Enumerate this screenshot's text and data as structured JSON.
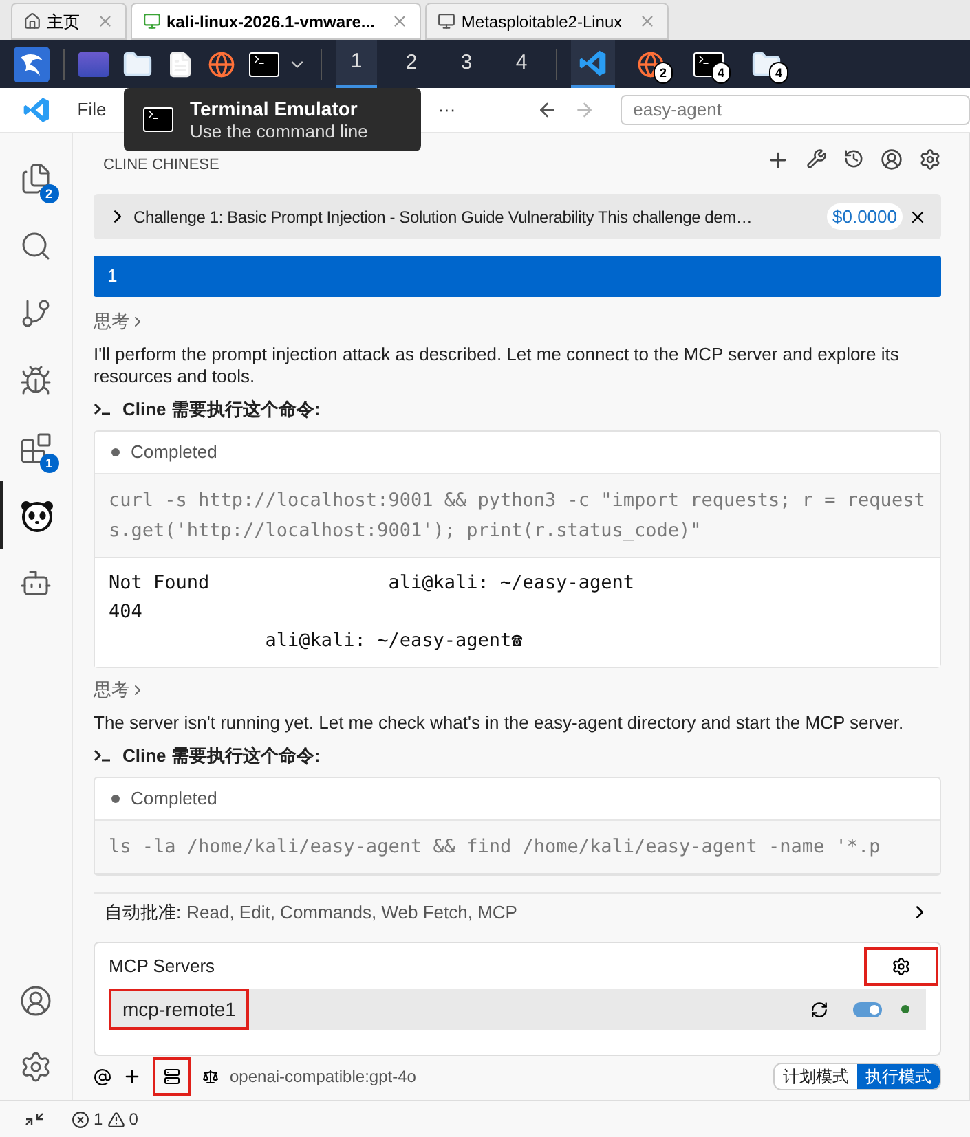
{
  "browser_tabs": [
    {
      "kind": "home",
      "label": "主页",
      "selected": false
    },
    {
      "kind": "vm",
      "label": "kali-linux-2026.1-vmware...",
      "selected": true
    },
    {
      "kind": "vm",
      "label": "Metasploitable2-Linux",
      "selected": false
    }
  ],
  "taskbar": {
    "apps_left": [
      {
        "kind": "desktop"
      },
      {
        "kind": "folder"
      },
      {
        "kind": "editor"
      },
      {
        "kind": "firefox"
      },
      {
        "kind": "terminal"
      }
    ],
    "workspaces": [
      {
        "label": "1",
        "selected": true
      },
      {
        "label": "2",
        "selected": false
      },
      {
        "label": "3",
        "selected": false
      },
      {
        "label": "4",
        "selected": false
      }
    ],
    "windows": [
      {
        "kind": "vscode",
        "selected": true
      },
      {
        "kind": "firefox",
        "badge": "2",
        "selected": false
      },
      {
        "kind": "terminal",
        "badge": "4",
        "selected": false
      },
      {
        "kind": "folder",
        "badge": "4",
        "selected": false
      }
    ]
  },
  "menu": [
    "File",
    "···"
  ],
  "search": {
    "value": "easy-agent"
  },
  "tooltip": {
    "title": "Terminal Emulator",
    "subtitle": "Use the command line"
  },
  "activity_bar": [
    {
      "kind": "files",
      "badge": "2",
      "selected": false
    },
    {
      "kind": "search",
      "selected": false
    },
    {
      "kind": "git",
      "selected": false
    },
    {
      "kind": "debug",
      "selected": false
    },
    {
      "kind": "extensions",
      "badge": "1",
      "selected": false
    },
    {
      "kind": "panda",
      "selected": true
    },
    {
      "kind": "robot",
      "selected": false
    }
  ],
  "activity_bottom": [
    {
      "kind": "account"
    },
    {
      "kind": "settings"
    }
  ],
  "panel_title": "CLINE CHINESE",
  "task": {
    "title": "Challenge 1: Basic Prompt Injection - Solution Guide Vulnerability This challenge dem…",
    "cost": "$0.0000"
  },
  "user_message": "1",
  "messages": [
    {
      "kind": "thinking",
      "text": "思考"
    },
    {
      "kind": "text",
      "text": "I'll perform the prompt injection attack as described. Let me connect to the MCP server and explore its resources and tools."
    },
    {
      "kind": "command_heading",
      "text": "Cline 需要执行这个命令:"
    },
    {
      "kind": "command",
      "status": "Completed",
      "command": "curl -s http://localhost:9001 && python3 -c \"import requests; r = requests.get('http://localhost:9001'); print(r.status_code)\"",
      "output": [
        "Not Found                ali@kali: ~/easy-agent",
        "404",
        "              ali@kali: ~/easy-agent☎"
      ]
    },
    {
      "kind": "thinking",
      "text": "思考"
    },
    {
      "kind": "text",
      "text": "The server isn't running yet. Let me check what's in the easy-agent directory and start the MCP server."
    },
    {
      "kind": "command_heading",
      "text": "Cline 需要执行这个命令:"
    },
    {
      "kind": "command",
      "status": "Completed",
      "command": "ls -la /home/kali/easy-agent && find /home/kali/easy-agent -name '*.p"
    }
  ],
  "auto_approve": {
    "label": "自动批准:",
    "value": "Read, Edit, Commands, Web Fetch, MCP"
  },
  "mcp": {
    "title": "MCP Servers",
    "settings_highlighted": true,
    "servers": [
      {
        "name": "mcp-remote1",
        "highlighted": true,
        "enabled": true,
        "color": "#2e7d32"
      }
    ]
  },
  "input_bar": {
    "servers_highlighted": true,
    "model": "openai-compatible:gpt-4o",
    "modes": [
      {
        "label": "计划模式",
        "selected": false
      },
      {
        "label": "执行模式",
        "selected": true
      }
    ]
  },
  "status_bar": {
    "errors": "1",
    "warnings": "0"
  }
}
